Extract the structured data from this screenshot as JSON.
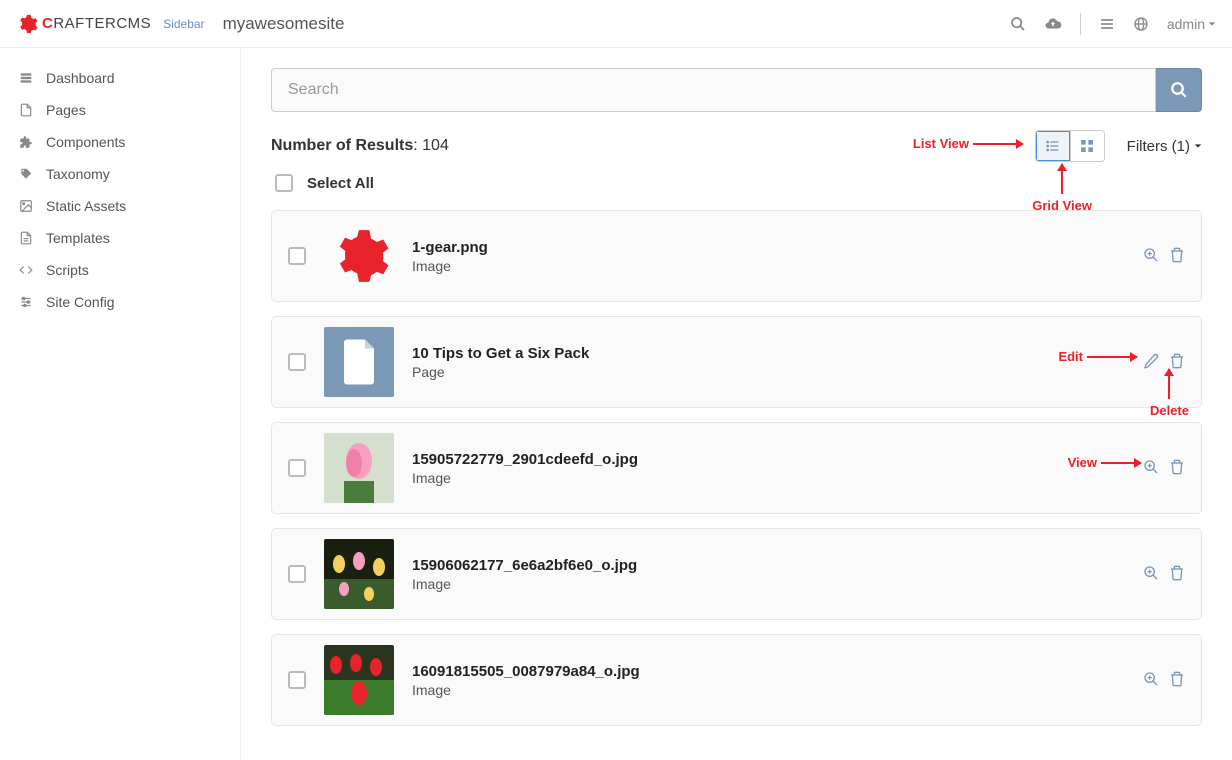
{
  "header": {
    "logo_prefix": "C",
    "logo_rest": "RAFTERCMS",
    "sidebar_toggle": "Sidebar",
    "site_name": "myawesomesite",
    "user_label": "admin"
  },
  "sidebar": {
    "items": [
      {
        "label": "Dashboard"
      },
      {
        "label": "Pages"
      },
      {
        "label": "Components"
      },
      {
        "label": "Taxonomy"
      },
      {
        "label": "Static Assets"
      },
      {
        "label": "Templates"
      },
      {
        "label": "Scripts"
      },
      {
        "label": "Site Config"
      }
    ]
  },
  "search": {
    "placeholder": "Search"
  },
  "results": {
    "label": "Number of Results",
    "count": "104",
    "select_all": "Select All",
    "filters_label": "Filters (1)"
  },
  "annotations": {
    "list_view": "List View",
    "grid_view": "Grid View",
    "edit": "Edit",
    "delete": "Delete",
    "view": "View"
  },
  "items": [
    {
      "title": "1-gear.png",
      "type": "Image",
      "actions": [
        "view",
        "delete"
      ]
    },
    {
      "title": "10 Tips to Get a Six Pack",
      "type": "Page",
      "actions": [
        "edit",
        "delete"
      ]
    },
    {
      "title": "15905722779_2901cdeefd_o.jpg",
      "type": "Image",
      "actions": [
        "view",
        "delete"
      ]
    },
    {
      "title": "15906062177_6e6a2bf6e0_o.jpg",
      "type": "Image",
      "actions": [
        "view",
        "delete"
      ]
    },
    {
      "title": "16091815505_0087979a84_o.jpg",
      "type": "Image",
      "actions": [
        "view",
        "delete"
      ]
    }
  ]
}
